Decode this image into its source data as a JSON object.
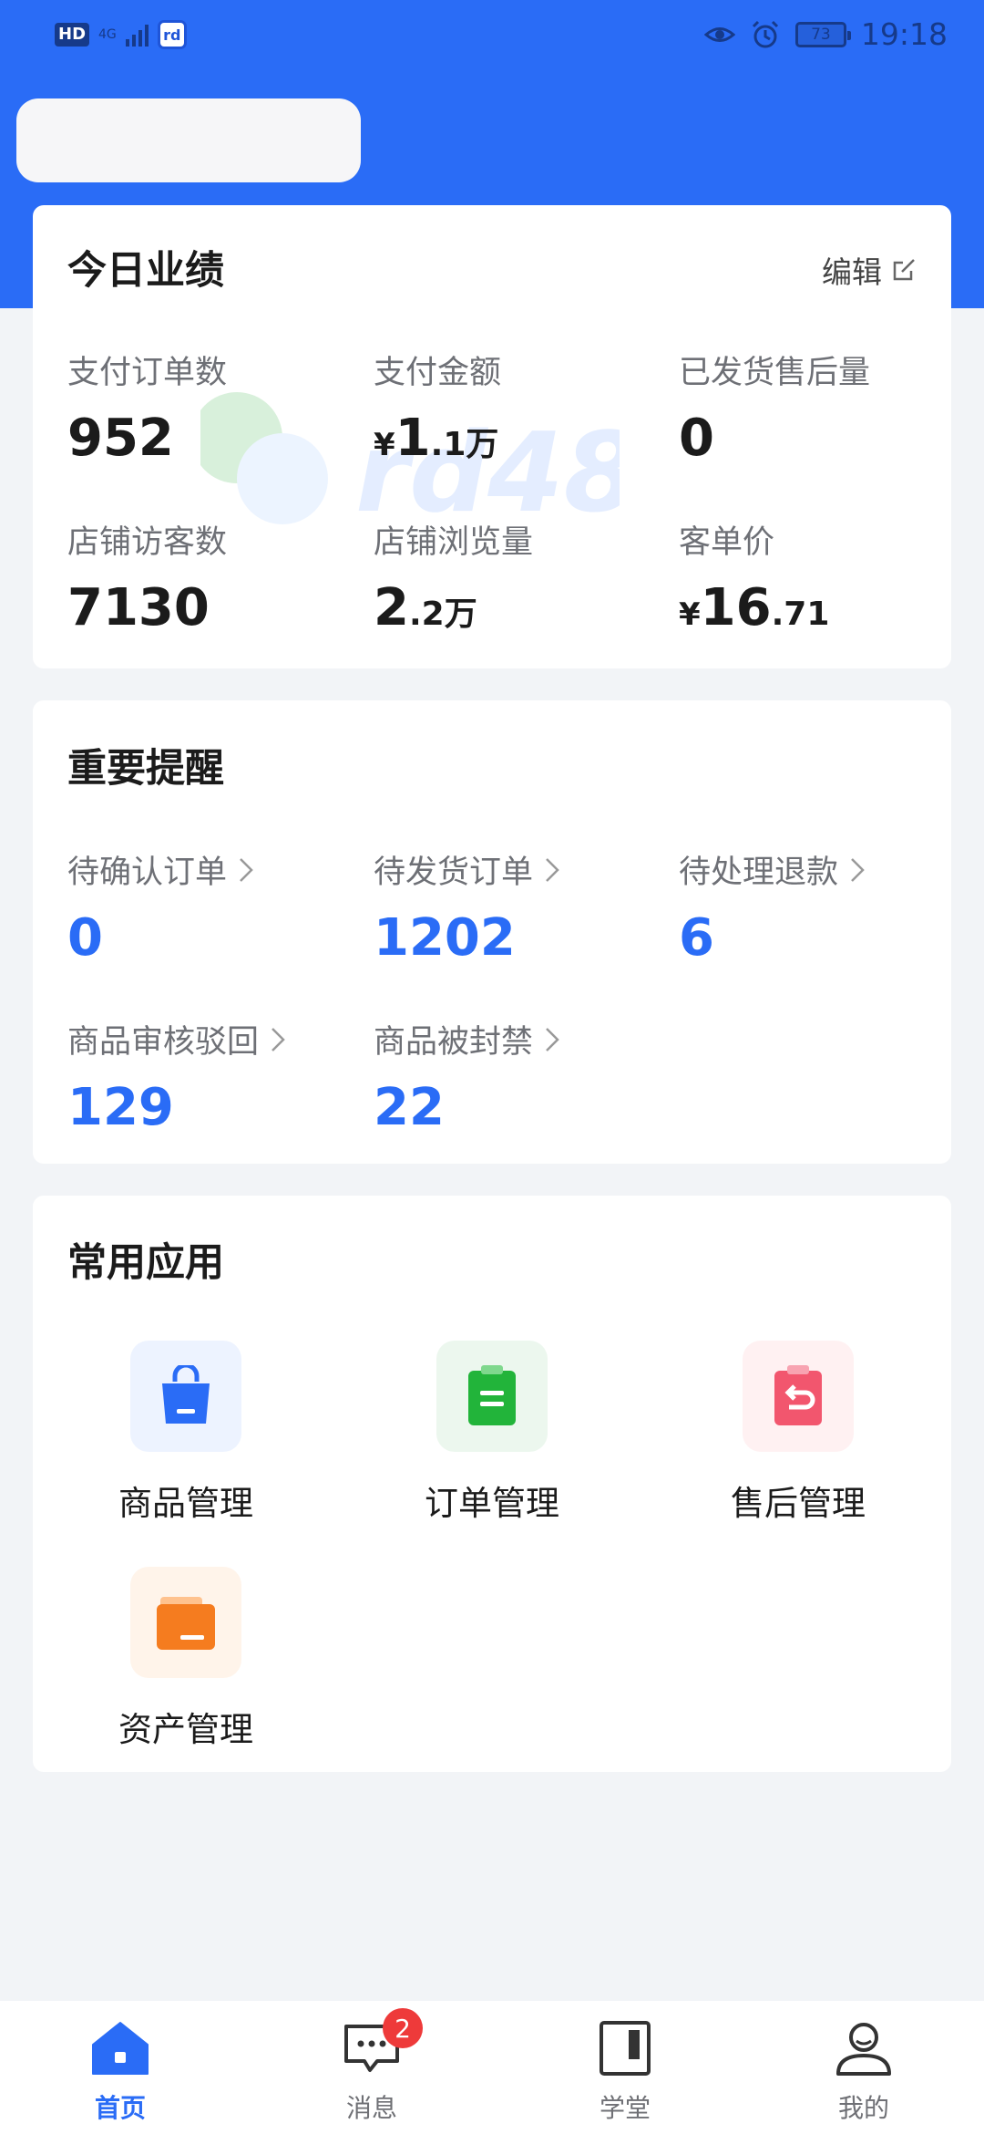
{
  "status_bar": {
    "hd": "HD",
    "network": "4G",
    "battery": "73",
    "time": "19:18"
  },
  "today": {
    "title": "今日业绩",
    "edit_label": "编辑",
    "metrics": [
      {
        "label": "支付订单数",
        "value": "952"
      },
      {
        "label": "支付金额",
        "currency": "¥",
        "value": "1",
        "decimal": ".1",
        "unit": "万"
      },
      {
        "label": "已发货售后量",
        "value": "0"
      },
      {
        "label": "店铺访客数",
        "value": "7130"
      },
      {
        "label": "店铺浏览量",
        "value": "2",
        "decimal": ".2",
        "unit": "万"
      },
      {
        "label": "客单价",
        "currency": "¥",
        "value": "16",
        "decimal": ".71"
      }
    ]
  },
  "reminders": {
    "title": "重要提醒",
    "items": [
      {
        "label": "待确认订单",
        "value": "0"
      },
      {
        "label": "待发货订单",
        "value": "1202"
      },
      {
        "label": "待处理退款",
        "value": "6"
      },
      {
        "label": "商品审核驳回",
        "value": "129"
      },
      {
        "label": "商品被封禁",
        "value": "22"
      }
    ]
  },
  "apps": {
    "title": "常用应用",
    "items": [
      {
        "label": "商品管理",
        "icon": "shopping-bag-icon",
        "color": "#2a6cf6"
      },
      {
        "label": "订单管理",
        "icon": "order-clipboard-icon",
        "color": "#22b43a"
      },
      {
        "label": "售后管理",
        "icon": "return-clipboard-icon",
        "color": "#f2566e"
      },
      {
        "label": "资产管理",
        "icon": "wallet-icon",
        "color": "#f57c1f"
      }
    ]
  },
  "tabbar": {
    "items": [
      {
        "label": "首页",
        "icon": "home-icon",
        "active": true
      },
      {
        "label": "消息",
        "icon": "message-icon",
        "badge": "2"
      },
      {
        "label": "学堂",
        "icon": "school-icon"
      },
      {
        "label": "我的",
        "icon": "profile-icon"
      }
    ]
  },
  "colors": {
    "brand": "#2a6cf6",
    "background": "#f2f4f7",
    "badge": "#ee3a3a"
  }
}
